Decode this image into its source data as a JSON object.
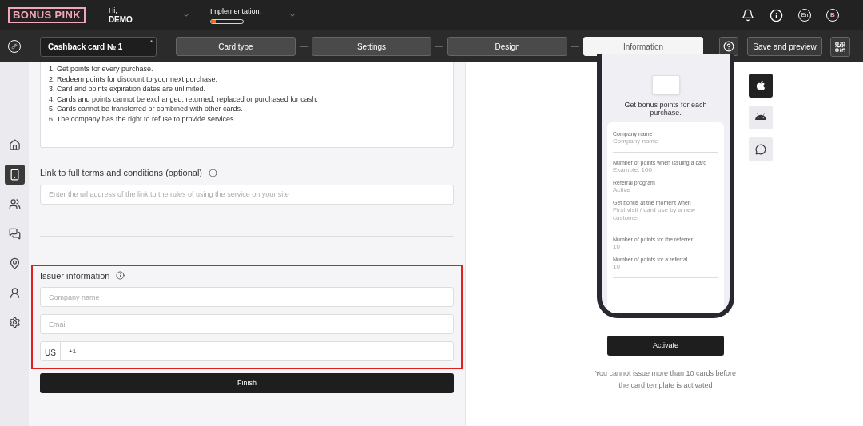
{
  "header": {
    "logo": "BONUS PINK",
    "greeting": "Hi,",
    "user": "DEMO",
    "implementation": {
      "label": "Implementation:",
      "level": 0.15
    },
    "language": "En",
    "avatar": "B"
  },
  "toolbar": {
    "card_name": "Cashback card № 1",
    "card_name_mark": "*",
    "steps": [
      {
        "label": "Card type",
        "selected": false
      },
      {
        "label": "Settings",
        "selected": false
      },
      {
        "label": "Design",
        "selected": false
      },
      {
        "label": "Information",
        "selected": true
      }
    ],
    "save_button": "Save and preview"
  },
  "sidebar": {
    "items": [
      {
        "kind": "home",
        "selected": false
      },
      {
        "kind": "cards",
        "selected": true
      },
      {
        "kind": "clients",
        "selected": false
      },
      {
        "kind": "messages",
        "selected": false
      },
      {
        "kind": "locations",
        "selected": false
      },
      {
        "kind": "profile",
        "selected": false
      },
      {
        "kind": "settings",
        "selected": false
      }
    ]
  },
  "form": {
    "terms_lines": [
      "1. Get points for every purchase.",
      "2. Redeem points for discount to your next purchase.",
      "3. Card and points expiration dates are unlimited.",
      "4. Cards and points cannot be exchanged, returned, replaced or purchased for cash.",
      "5. Cards cannot be transferred or combined with other cards.",
      "6. The company has the right to refuse to provide services."
    ],
    "link_label": "Link to full terms and conditions (optional)",
    "link_placeholder": "Enter the url address of the link to the rules of using the service on your site",
    "issuer": {
      "title": "Issuer information",
      "company_placeholder": "Company name",
      "email_placeholder": "Email",
      "country": "US",
      "phone_value": "+1"
    },
    "finish_button": "Finish"
  },
  "preview": {
    "title": "Get bonus points for each purchase.",
    "groups": [
      [
        {
          "label": "Company name",
          "value": "Company name"
        }
      ],
      [
        {
          "label": "Number of points when issuing a card",
          "value": "Example: 100"
        },
        {
          "label": "Referral program",
          "value": "Active"
        },
        {
          "label": "Get bonus at the moment when",
          "value": "First visit / card use by a new customer"
        }
      ],
      [
        {
          "label": "Number of points for the referrer",
          "value": "10"
        },
        {
          "label": "Number of points for a referral",
          "value": "10"
        }
      ]
    ],
    "platforms": [
      {
        "kind": "apple",
        "selected": true
      },
      {
        "kind": "android",
        "selected": false
      },
      {
        "kind": "chat",
        "selected": false
      }
    ],
    "activate_button": "Activate",
    "note": "You cannot issue more than 10 cards before the card template is activated"
  }
}
